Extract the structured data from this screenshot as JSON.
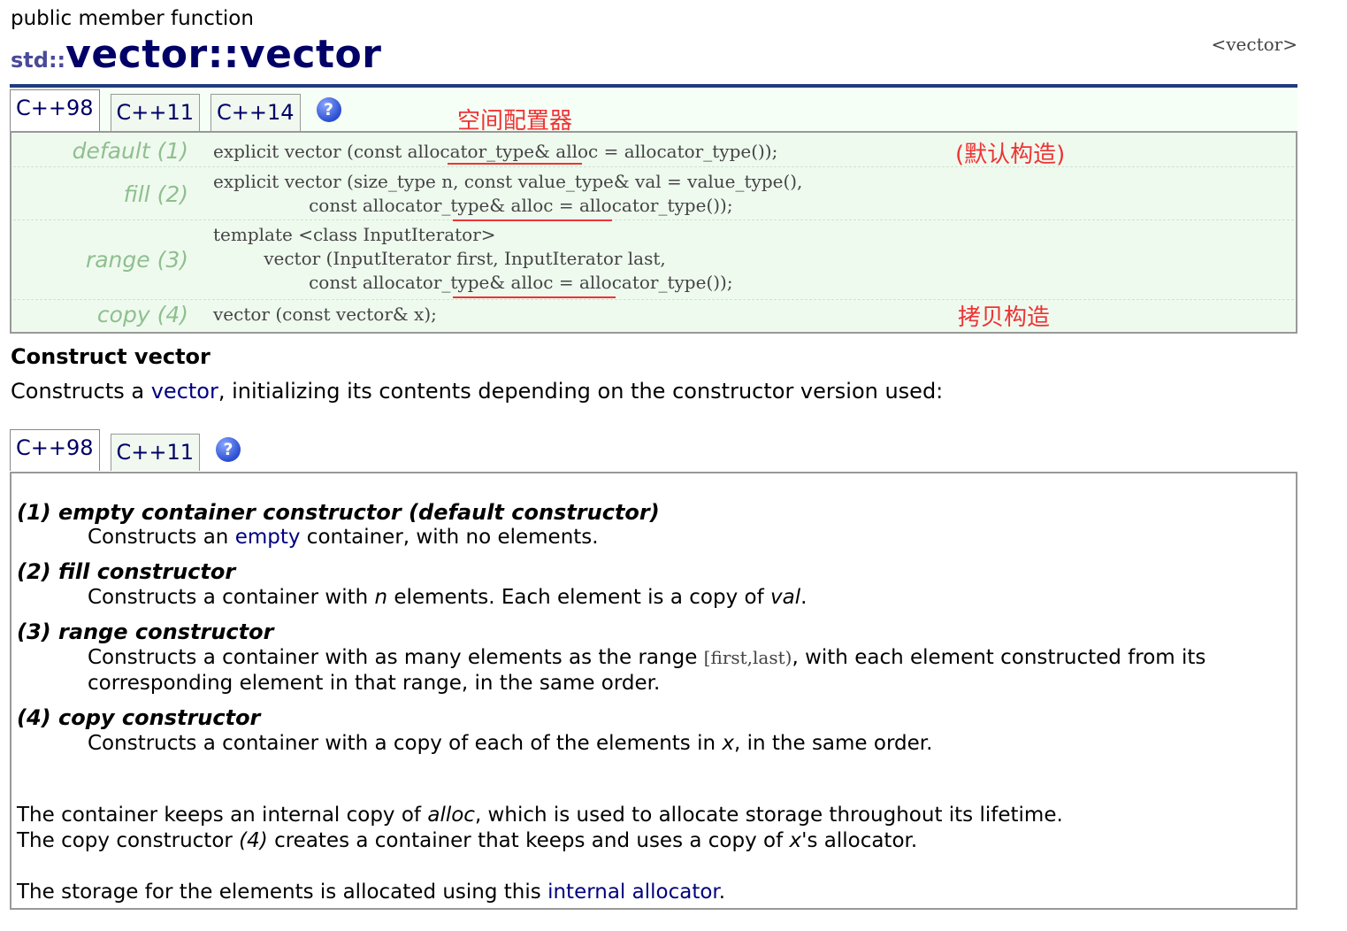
{
  "header": {
    "kind": "public member function",
    "namespace": "std::",
    "name": "vector::vector",
    "library": "<vector>"
  },
  "tabs_top": [
    {
      "label": "C++98",
      "active": true
    },
    {
      "label": "C++11",
      "active": false
    },
    {
      "label": "C++14",
      "active": false
    }
  ],
  "help_label": "?",
  "signatures": [
    {
      "label": "default (1)",
      "lines": [
        "explicit vector (const allocator_type& alloc = allocator_type());"
      ]
    },
    {
      "label": "fill (2)",
      "lines": [
        "explicit vector (size_type n, const value_type& val = value_type(),",
        "                 const allocator_type& alloc = allocator_type());"
      ]
    },
    {
      "label": "range (3)",
      "lines": [
        "template <class InputIterator>",
        "         vector (InputIterator first, InputIterator last,",
        "                 const allocator_type& alloc = allocator_type());"
      ]
    },
    {
      "label": "copy (4)",
      "lines": [
        "vector (const vector& x);"
      ]
    }
  ],
  "annotations": {
    "allocator": "空间配置器",
    "default_ctor": "(默认构造)",
    "copy_ctor": "拷贝构造"
  },
  "section": {
    "title": "Construct vector",
    "intro_before": "Constructs a ",
    "intro_link": "vector",
    "intro_after": ", initializing its contents depending on the constructor version used:"
  },
  "tabs_bottom": [
    {
      "label": "C++98",
      "active": true
    },
    {
      "label": "C++11",
      "active": false
    }
  ],
  "constructors": {
    "c1_title": "(1) empty container constructor (default constructor)",
    "c1_a": "Constructs an ",
    "c1_link": "empty",
    "c1_b": " container, with no elements.",
    "c2_title": "(2) fill constructor",
    "c2_a": "Constructs a container with ",
    "c2_n": "n",
    "c2_b": " elements. Each element is a copy of ",
    "c2_val": "val",
    "c2_c": ".",
    "c3_title": "(3) range constructor",
    "c3_a": "Constructs a container with as many elements as the range ",
    "c3_range": "[first,last)",
    "c3_b": ", with each element constructed from its",
    "c3_line2": "corresponding element in that range, in the same order.",
    "c4_title": "(4) copy constructor",
    "c4_a": "Constructs a container with a copy of each of the elements in ",
    "c4_x": "x",
    "c4_b": ", in the same order."
  },
  "notes": {
    "p1_a": "The container keeps an internal copy of ",
    "p1_alloc": "alloc",
    "p1_b": ", which is used to allocate storage throughout its lifetime.",
    "p2_a": "The copy constructor ",
    "p2_4": "(4)",
    "p2_b": " creates a container that keeps and uses a copy of ",
    "p2_x": "x",
    "p2_c": "'s allocator.",
    "p3_a": "The storage for the elements is allocated using this ",
    "p3_link": "internal allocator",
    "p3_b": "."
  }
}
